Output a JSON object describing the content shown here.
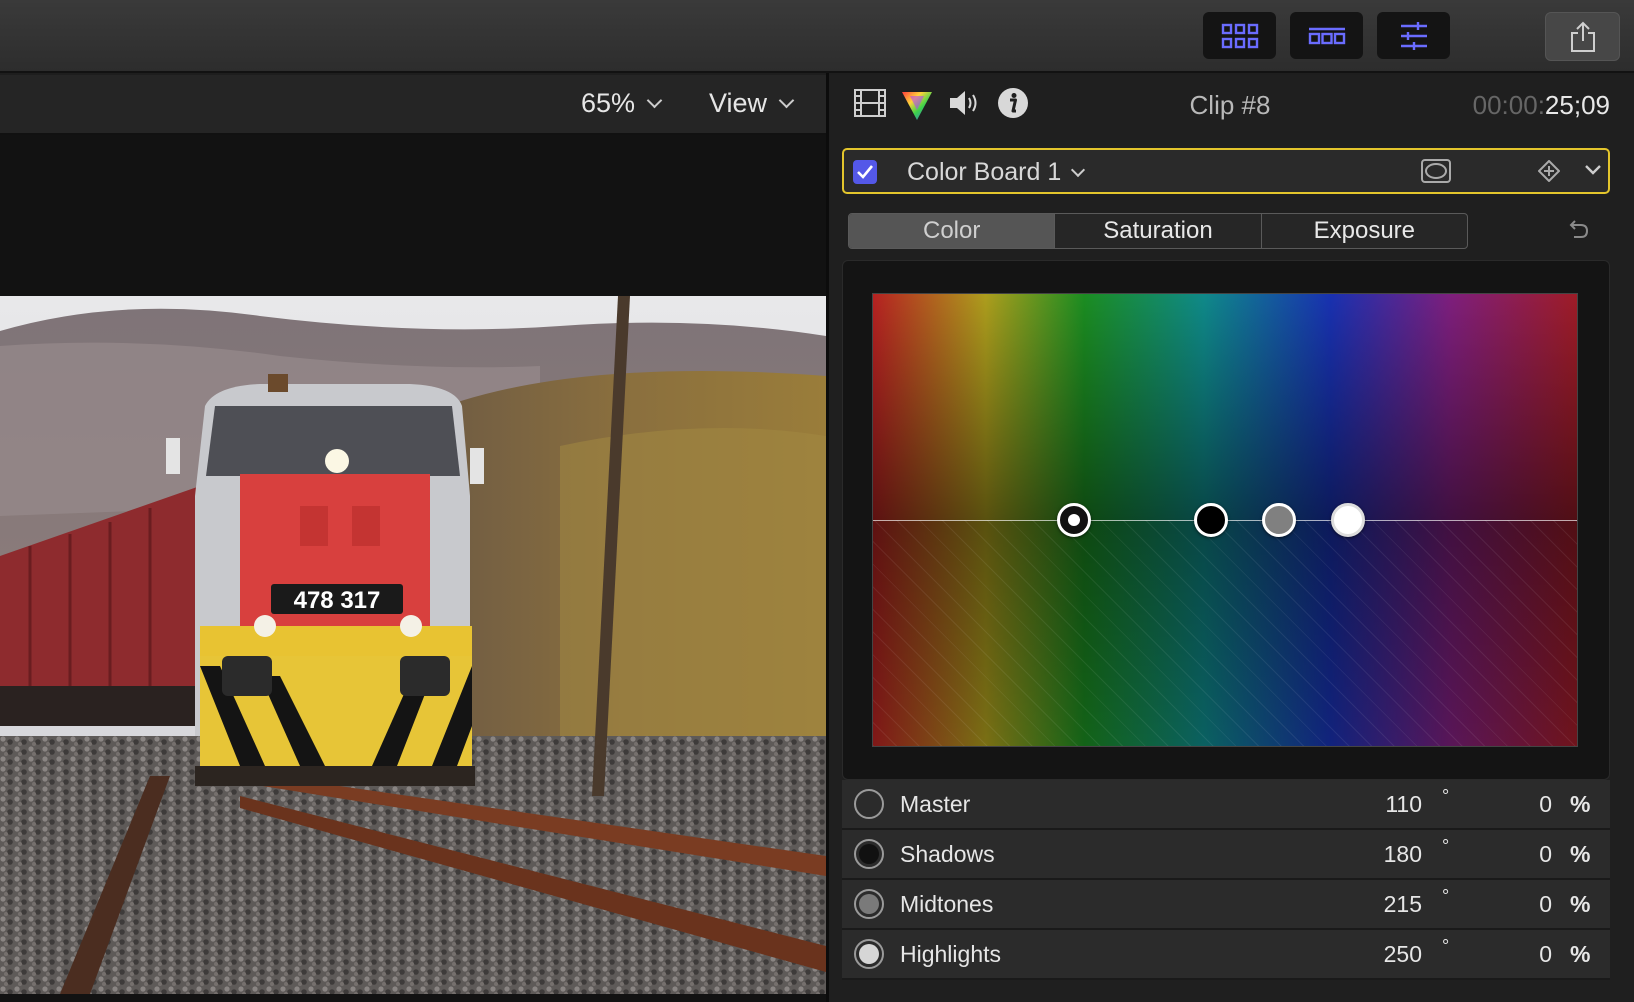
{
  "viewer": {
    "zoom_label": "65%",
    "view_label": "View"
  },
  "video": {
    "locomotive_number": "478 317"
  },
  "inspector": {
    "clip_name": "Clip #8",
    "timecode_dim": "00:00:",
    "timecode_bright": "25;09",
    "effect": {
      "name": "Color Board 1",
      "enabled": true
    },
    "tabs": [
      {
        "label": "Color",
        "active": true
      },
      {
        "label": "Saturation",
        "active": false
      },
      {
        "label": "Exposure",
        "active": false
      }
    ],
    "pucks": [
      {
        "name": "Master",
        "value": 110
      },
      {
        "name": "Shadows",
        "value": 180
      },
      {
        "name": "Midtones",
        "value": 215
      },
      {
        "name": "Highlights",
        "value": 250
      }
    ],
    "rows": [
      {
        "label": "Master",
        "degrees": "110",
        "degree_symbol": "°",
        "percent": "0",
        "percent_symbol": "%",
        "swatch": ""
      },
      {
        "label": "Shadows",
        "degrees": "180",
        "degree_symbol": "°",
        "percent": "0",
        "percent_symbol": "%",
        "swatch": "#111111"
      },
      {
        "label": "Midtones",
        "degrees": "215",
        "degree_symbol": "°",
        "percent": "0",
        "percent_symbol": "%",
        "swatch": "#7a7a7a"
      },
      {
        "label": "Highlights",
        "degrees": "250",
        "degree_symbol": "°",
        "percent": "0",
        "percent_symbol": "%",
        "swatch": "#d6d6d6"
      }
    ]
  },
  "colors": {
    "accent_check": "#5458e8",
    "selection_border": "#e3c52c",
    "toolbar_icon": "#6a6cff"
  },
  "icons": {
    "toolbar": [
      "browser-grid-icon",
      "timeline-filmstrip-icon",
      "inspector-sliders-icon",
      "share-icon"
    ],
    "inspector_tabs": [
      "film-icon",
      "color-prism-icon",
      "speaker-icon",
      "info-icon"
    ],
    "effect_row": [
      "mask-icon",
      "keyframe-diamond-icon",
      "disclosure-chevron-icon"
    ],
    "reset": "reset-arrow-icon"
  }
}
